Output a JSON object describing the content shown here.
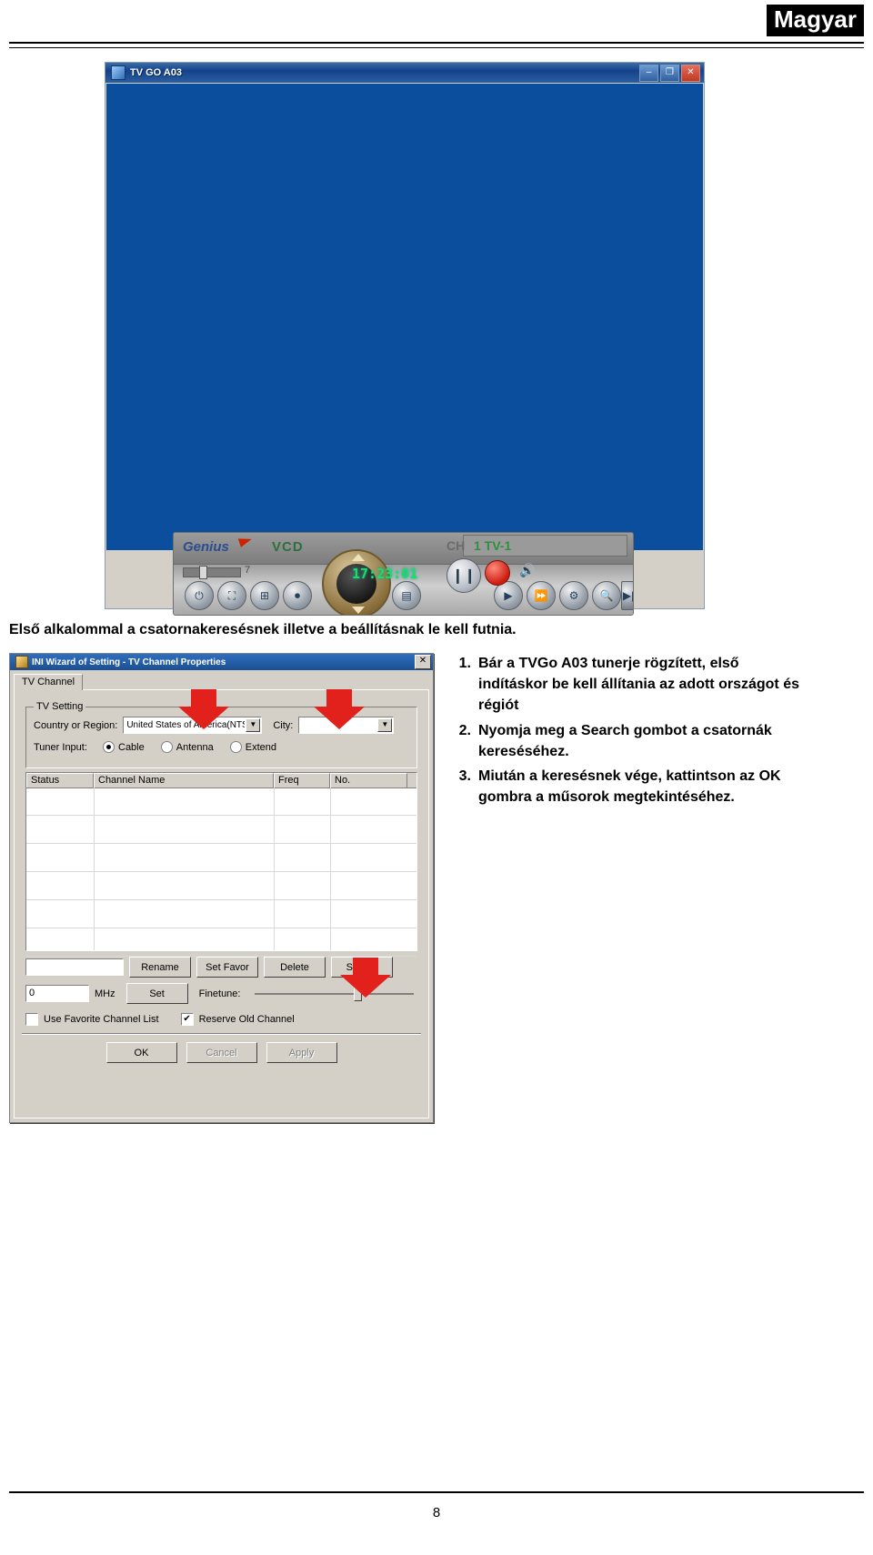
{
  "header": {
    "language_badge": "Magyar"
  },
  "tv_window": {
    "title": "TV GO A03",
    "buttons": {
      "minimize": "–",
      "maximize": "❐",
      "close": "✕"
    }
  },
  "player": {
    "brand": "Genius",
    "source": "VCD",
    "ch_label": "CH",
    "ch_value": "1 TV-1",
    "volume_value": "7",
    "clock": "17:23:01",
    "controls": [
      {
        "name": "power-button",
        "glyph": "⏻"
      },
      {
        "name": "fullscreen-button",
        "glyph": "⛶"
      },
      {
        "name": "preview-grid-button",
        "glyph": "⊞"
      },
      {
        "name": "snapshot-button",
        "glyph": "⏺"
      },
      {
        "name": "playlist-button",
        "glyph": "▤"
      },
      {
        "name": "play-button",
        "glyph": "▶"
      },
      {
        "name": "timeshift-button",
        "glyph": "⏩"
      },
      {
        "name": "settings-button",
        "glyph": "⚙"
      },
      {
        "name": "search-button",
        "glyph": "🔍"
      },
      {
        "name": "next-button",
        "glyph": "▶|"
      }
    ],
    "pause_glyph": "❙❙",
    "speaker_glyph": "🔊"
  },
  "caption": "Első alkalommal a csatornakeresésnek illetve a beállításnak le kell futnia.",
  "wizard": {
    "title": "INI Wizard of Setting - TV Channel Properties",
    "close_label": "✕",
    "tab": "TV Channel",
    "group_label": "TV Setting",
    "country_label": "Country or Region:",
    "country_value": "United States of America(NTSC)",
    "city_label": "City:",
    "city_value": "",
    "tuner_label": "Tuner Input:",
    "tuner_options": [
      "Cable",
      "Antenna",
      "Extend"
    ],
    "tuner_selected": "Cable",
    "columns": [
      "Status",
      "Channel Name",
      "Freq",
      "No."
    ],
    "rows": [],
    "name_field_value": "",
    "buttons": {
      "rename": "Rename",
      "set_favor": "Set Favor",
      "delete": "Delete",
      "search": "Search",
      "set": "Set",
      "ok": "OK",
      "cancel": "Cancel",
      "apply": "Apply"
    },
    "freq_value": "0",
    "freq_unit": "MHz",
    "finetune_label": "Finetune:",
    "checkboxes": [
      {
        "label": "Use Favorite Channel List",
        "checked": false
      },
      {
        "label": "Reserve Old Channel",
        "checked": true
      }
    ]
  },
  "steps": [
    {
      "num": "1.",
      "text": "Bár a TVGo A03 tunerje rögzített, első indításkor be kell állítania az adott országot és régiót"
    },
    {
      "num": "2.",
      "text": "Nyomja meg a Search gombot a csatornák kereséséhez."
    },
    {
      "num": "3.",
      "text": "Miután a keresésnek vége, kattintson az OK gombra a műsorok megtekintéséhez."
    }
  ],
  "footer": {
    "page_number": "8"
  }
}
